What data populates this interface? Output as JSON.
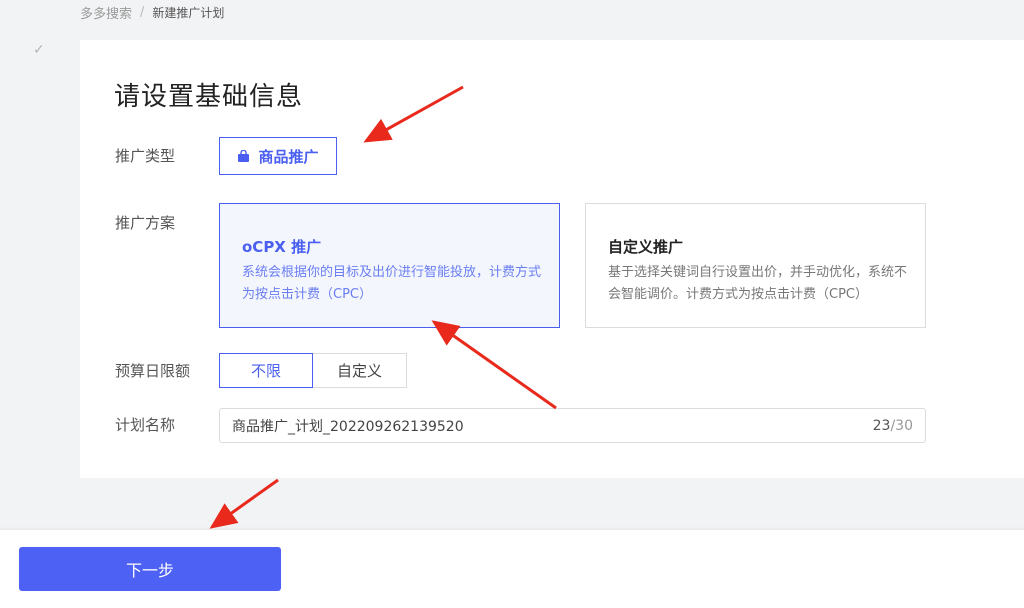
{
  "breadcrumb": {
    "parent": "多多搜索",
    "separator": "/",
    "current": "新建推广计划"
  },
  "step": {
    "icon": "check-icon",
    "glyph": "✓"
  },
  "form": {
    "title": "请设置基础信息",
    "promo_type": {
      "label": "推广类型",
      "option": "商品推广",
      "icon": "shopping-bag-icon"
    },
    "plan": {
      "label": "推广方案",
      "options": [
        {
          "title": "oCPX 推广",
          "desc": "系统会根据你的目标及出价进行智能投放，计费方式为按点击计费（CPC）",
          "selected": true
        },
        {
          "title": "自定义推广",
          "desc": "基于选择关键词自行设置出价，并手动优化，系统不会智能调价。计费方式为按点击计费（CPC）",
          "selected": false
        }
      ]
    },
    "budget": {
      "label": "预算日限额",
      "options": [
        "不限",
        "自定义"
      ],
      "selected": "不限"
    },
    "plan_name": {
      "label": "计划名称",
      "value": "商品推广_计划_202209262139520",
      "count": "23",
      "max": "/30"
    }
  },
  "footer": {
    "next_label": "下一步"
  },
  "colors": {
    "accent": "#4a5ff0",
    "button": "#4e61f5",
    "arrow": "#e8291c"
  }
}
